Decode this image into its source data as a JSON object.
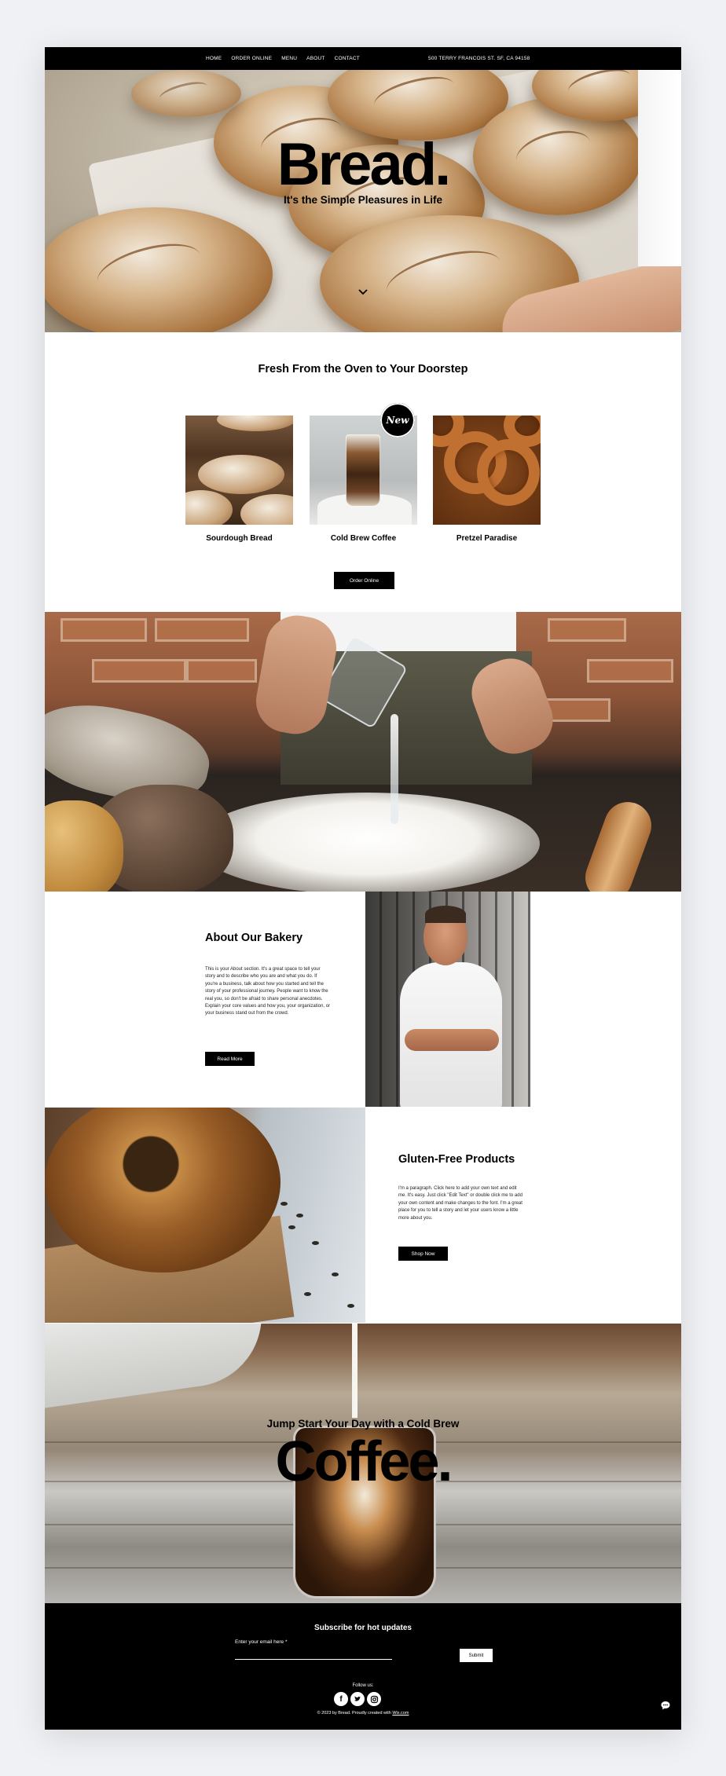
{
  "nav": {
    "items": [
      "HOME",
      "ORDER ONLINE",
      "MENU",
      "ABOUT",
      "CONTACT"
    ],
    "address": "500 TERRY FRANCOIS ST. SF, CA 94158"
  },
  "hero": {
    "title": "Bread.",
    "subtitle": "It's the Simple Pleasures in Life",
    "scroll_icon": "chevron-down-icon"
  },
  "products": {
    "heading": "Fresh From the Oven to Your Doorstep",
    "badge": "New",
    "items": [
      {
        "name": "Sourdough Bread"
      },
      {
        "name": "Cold Brew Coffee"
      },
      {
        "name": "Pretzel Paradise"
      }
    ],
    "order_button": "Order Online"
  },
  "about": {
    "title": "About Our Bakery",
    "text": "This is your About section. It's a great space to tell your story and to describe who you are and what you do. If you're a business, talk about how you started and tell the story of your professional journey. People want to know the real you, so don't be afraid to share personal anecdotes. Explain your core values and how you, your organization, or your business stand out from the crowd.",
    "button": "Read More"
  },
  "gluten_free": {
    "title": "Gluten-Free Products",
    "text": "I'm a paragraph. Click here to add your own text and edit me. It's easy. Just click \"Edit Text\" or double click me to add your own content and make changes to the font. I'm a great place for you to tell a story and let your users know a little more about you.",
    "button": "Shop Now"
  },
  "coffee": {
    "subtitle": "Jump Start Your Day with a Cold Brew",
    "title": "Coffee."
  },
  "footer": {
    "title": "Subscribe for hot updates",
    "email_label": "Enter your email here *",
    "email_value": "",
    "submit": "Submit",
    "follow": "Follow us:",
    "social": [
      "facebook-icon",
      "twitter-icon",
      "instagram-icon"
    ],
    "copyright_prefix": "© 2023 by Bread. Proudly created with ",
    "copyright_link": "Wix.com",
    "chat_icon": "chat-icon"
  }
}
